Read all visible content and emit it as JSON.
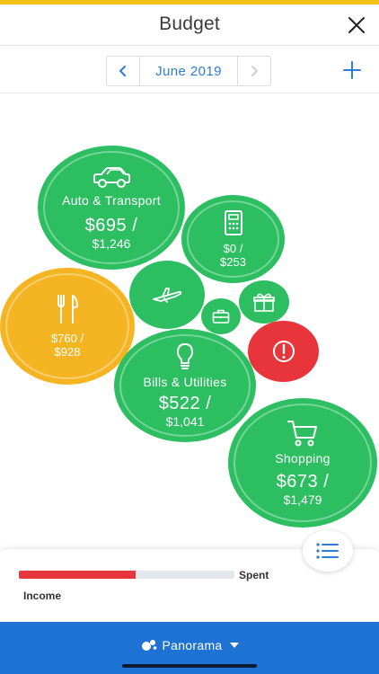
{
  "header": {
    "title": "Budget",
    "close_icon": "close-icon"
  },
  "month_picker": {
    "prev_icon": "chevron-left-icon",
    "label": "June 2019",
    "next_icon": "chevron-right-icon",
    "add_icon": "plus-icon"
  },
  "bubbles": {
    "auto": {
      "name": "Auto & Transport",
      "amount": "$695 /",
      "budget": "$1,246",
      "icon": "car-icon",
      "color": "#2cbe61"
    },
    "calc": {
      "amount": "$0 /",
      "budget": "$253",
      "icon": "calculator-icon",
      "color": "#2cbe61"
    },
    "food": {
      "amount": "$760 /",
      "budget": "$928",
      "icon": "fork-knife-icon",
      "color": "#f5b523"
    },
    "travel": {
      "icon": "airplane-icon",
      "color": "#2cbe61"
    },
    "briefcase": {
      "icon": "briefcase-icon",
      "color": "#2cbe61"
    },
    "gift": {
      "icon": "gift-icon",
      "color": "#2cbe61"
    },
    "alert": {
      "icon": "alert-icon",
      "color": "#e8343b"
    },
    "bills": {
      "name": "Bills & Utilities",
      "amount": "$522 /",
      "budget": "$1,041",
      "icon": "lightbulb-icon",
      "color": "#2cbe61"
    },
    "shopping": {
      "name": "Shopping",
      "amount": "$673 /",
      "budget": "$1,479",
      "icon": "cart-icon",
      "color": "#2cbe61"
    }
  },
  "summary": {
    "spent_label": "Spent",
    "income_label": "Income",
    "spent_progress": 0.54,
    "bar_color": "#e8343b",
    "list_icon": "list-icon"
  },
  "footer": {
    "label": "Panorama",
    "logo_icon": "panorama-logo-icon",
    "caret_icon": "caret-down-icon",
    "color": "#1d72d3"
  }
}
